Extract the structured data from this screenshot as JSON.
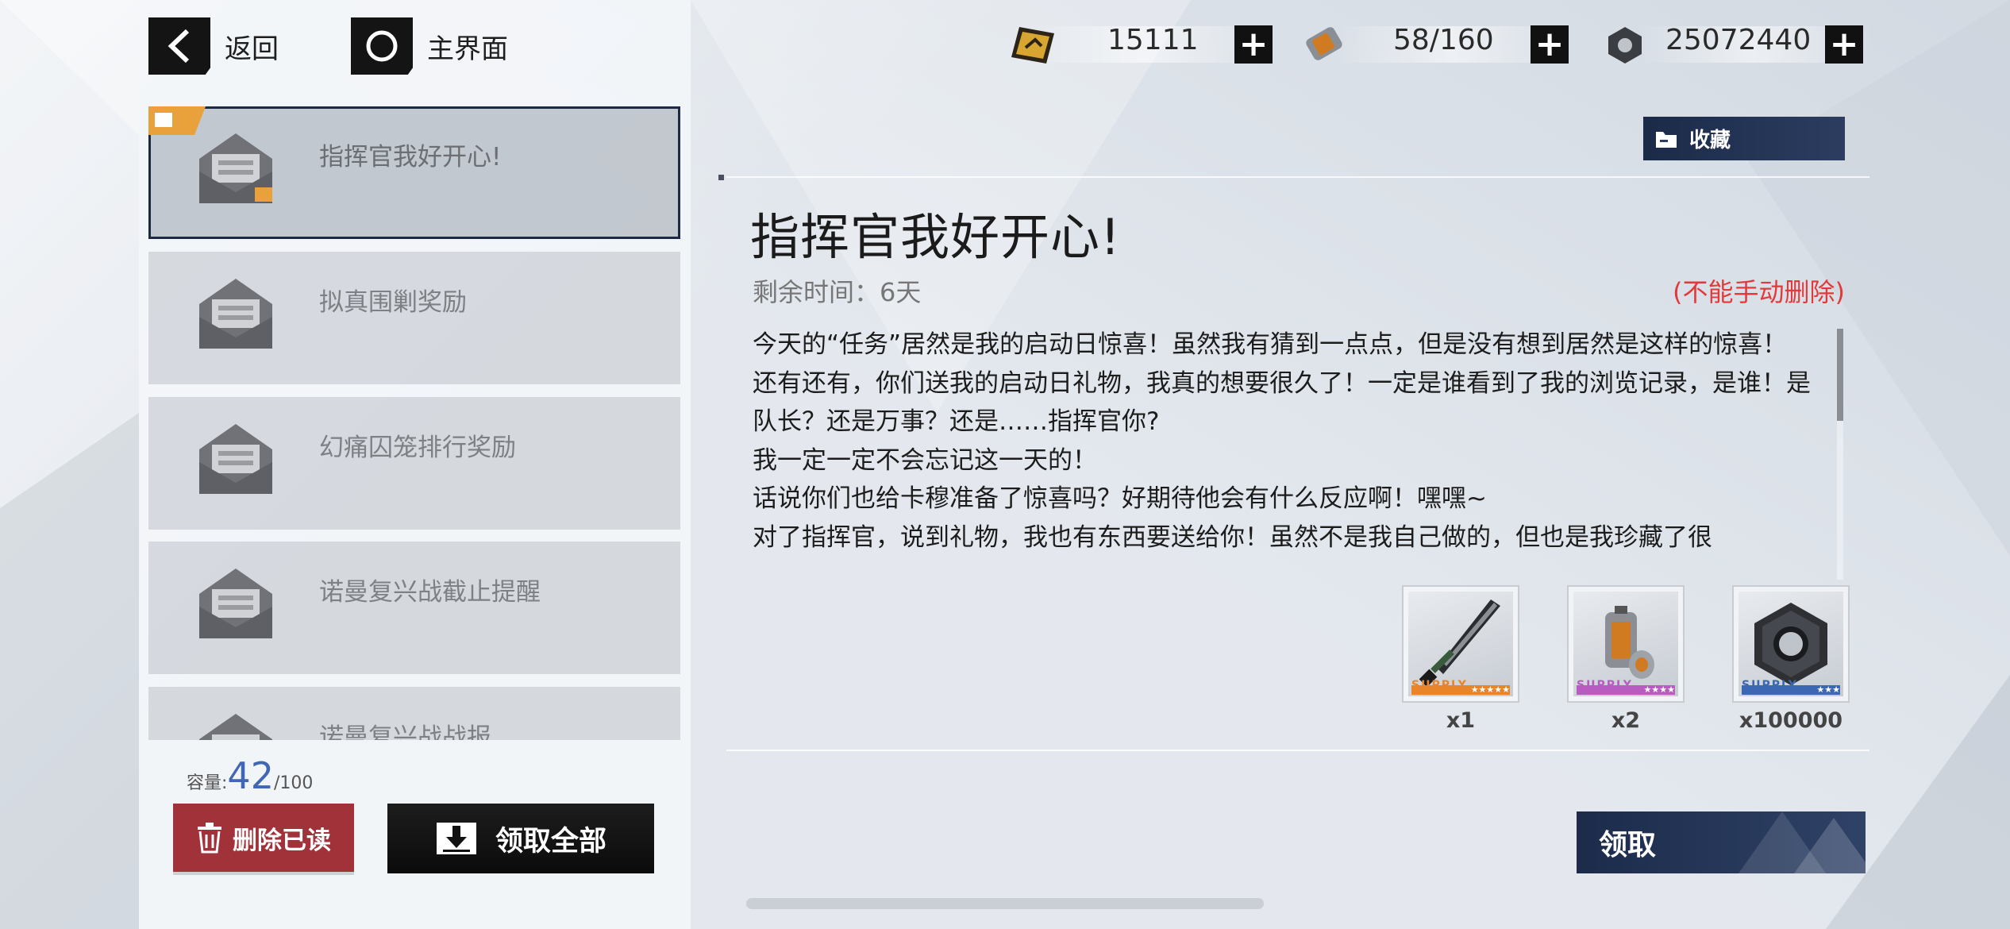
{
  "nav": {
    "back_label": "返回",
    "home_label": "主界面"
  },
  "resources": [
    {
      "icon": "gold-card-icon",
      "value": "15111"
    },
    {
      "icon": "battery-icon",
      "value": "58/160"
    },
    {
      "icon": "hex-nut-icon",
      "value": "25072440"
    }
  ],
  "mail_list": {
    "items": [
      {
        "title": "指挥官我好开心!",
        "selected": true
      },
      {
        "title": "拟真围剿奖励",
        "selected": false
      },
      {
        "title": "幻痛囚笼排行奖励",
        "selected": false
      },
      {
        "title": "诺曼复兴战截止提醒",
        "selected": false
      },
      {
        "title": "诺曼复兴战战报",
        "selected": false
      }
    ]
  },
  "capacity": {
    "label": "容量:",
    "current": "42",
    "max": "/100"
  },
  "actions": {
    "delete_read_label": "删除已读",
    "claim_all_label": "领取全部",
    "claim_label": "领取",
    "favorite_label": "收藏"
  },
  "detail": {
    "title": "指挥官我好开心!",
    "remaining": "剩余时间：6天",
    "no_delete_note": "(不能手动删除)",
    "body": [
      "今天的“任务”居然是我的启动日惊喜！虽然我有猜到一点点，但是没有想到居然是这样的惊喜！",
      "还有还有，你们送我的启动日礼物，我真的想要很久了！一定是谁看到了我的浏览记录，是谁！是队长？还是万事？还是……指挥官你?",
      "我一定一定不会忘记这一天的！",
      "话说你们也给卡穆准备了惊喜吗？好期待他会有什么反应啊！嘿嘿~",
      "对了指挥官，说到礼物，我也有东西要送给你！虽然不是我自己做的，但也是我珍藏了很"
    ]
  },
  "rewards": [
    {
      "icon": "sword-icon",
      "supply_label": "SUPPLY",
      "rarity": "★★★★★",
      "color": "#e8842a",
      "qty": "x1"
    },
    {
      "icon": "battery-item-icon",
      "supply_label": "SUPPLY",
      "rarity": "★★★★",
      "color": "#b85cc2",
      "qty": "x2"
    },
    {
      "icon": "hex-nut-item-icon",
      "supply_label": "SUPPLY",
      "rarity": "★★★",
      "color": "#3c67b3",
      "qty": "x100000"
    }
  ]
}
